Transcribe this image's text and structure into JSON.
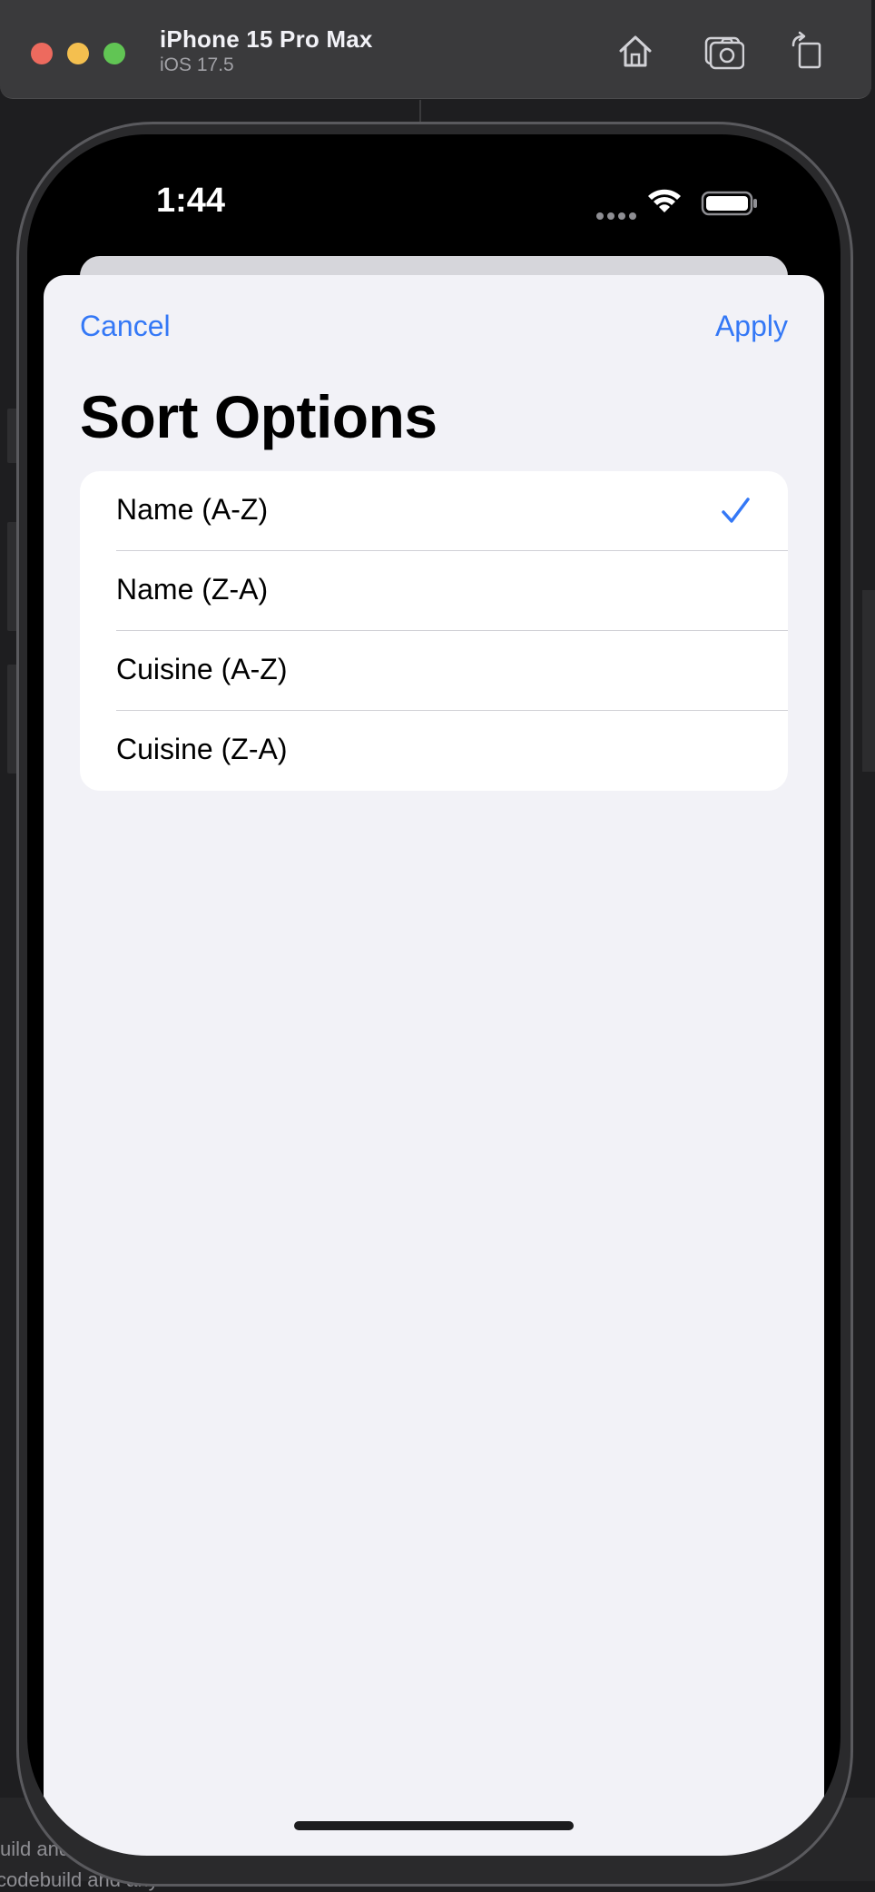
{
  "window": {
    "device_name": "iPhone 15 Pro Max",
    "os_version": "iOS 17.5",
    "toolbar_icons": [
      "home-icon",
      "screenshot-icon",
      "rotate-icon"
    ]
  },
  "status_bar": {
    "time": "1:44",
    "icons": [
      "signal-dots-icon",
      "wifi-icon",
      "battery-icon"
    ]
  },
  "sheet": {
    "cancel_label": "Cancel",
    "apply_label": "Apply",
    "title": "Sort Options",
    "options": [
      {
        "label": "Name (A-Z)",
        "selected": true
      },
      {
        "label": "Name (Z-A)",
        "selected": false
      },
      {
        "label": "Cuisine (A-Z)",
        "selected": false
      },
      {
        "label": "Cuisine (Z-A)",
        "selected": false
      }
    ]
  },
  "background": {
    "bottom_text_1": "uild and",
    "bottom_text_2": "codebuild and any available iPhone"
  },
  "colors": {
    "accent": "#3478f6",
    "sheet_background": "#f2f2f7",
    "titlebar": "#3a3a3c"
  }
}
